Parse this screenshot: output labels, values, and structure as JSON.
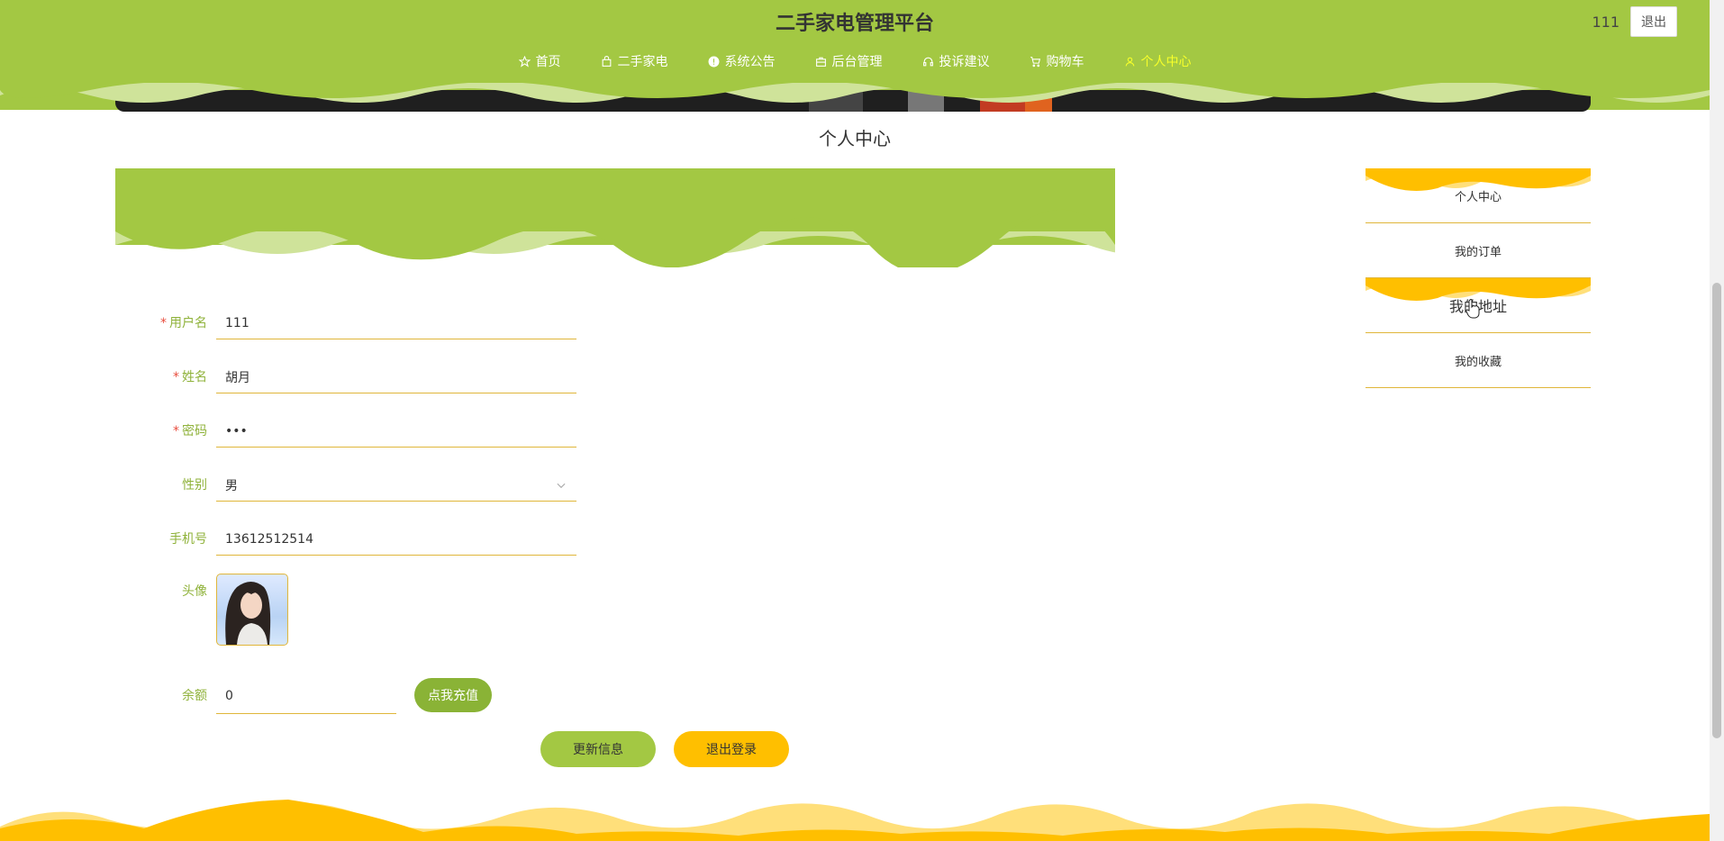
{
  "header": {
    "title": "二手家电管理平台",
    "user_name": "111",
    "logout_label": "退出",
    "nav": [
      {
        "label": "首页",
        "icon": "star-icon"
      },
      {
        "label": "二手家电",
        "icon": "bag-icon"
      },
      {
        "label": "系统公告",
        "icon": "info-icon"
      },
      {
        "label": "后台管理",
        "icon": "briefcase-icon"
      },
      {
        "label": "投诉建议",
        "icon": "headset-icon"
      },
      {
        "label": "购物车",
        "icon": "cart-icon"
      },
      {
        "label": "个人中心",
        "icon": "user-icon",
        "active": true
      }
    ]
  },
  "page": {
    "title": "个人中心"
  },
  "form": {
    "username": {
      "label": "用户名",
      "value": "111",
      "required": true
    },
    "name": {
      "label": "姓名",
      "value": "胡月",
      "required": true
    },
    "password": {
      "label": "密码",
      "value": "•••",
      "required": true
    },
    "gender": {
      "label": "性别",
      "value": "男"
    },
    "phone": {
      "label": "手机号",
      "value": "13612512514"
    },
    "avatar": {
      "label": "头像"
    },
    "balance": {
      "label": "余额",
      "value": "0"
    },
    "recharge_label": "点我充值",
    "update_label": "更新信息",
    "logout_label": "退出登录"
  },
  "side_menu": [
    {
      "label": "个人中心"
    },
    {
      "label": "我的订单"
    },
    {
      "label": "我的地址"
    },
    {
      "label": "我的收藏"
    }
  ],
  "colors": {
    "primary_green": "#a3c843",
    "accent_yellow": "#ffbf00",
    "active_nav": "#f7ff2a"
  }
}
